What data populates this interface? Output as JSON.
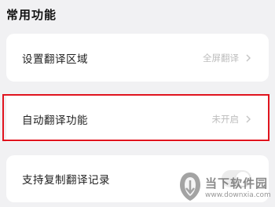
{
  "section": {
    "title": "常用功能"
  },
  "settings": [
    {
      "label": "设置翻译区域",
      "value": "全屏翻译"
    },
    {
      "label": "自动翻译功能",
      "value": "未开启"
    },
    {
      "label": "支持复制翻译记录"
    }
  ],
  "watermark": {
    "name": "当下软件园",
    "url": "www.downxia.com"
  },
  "colors": {
    "highlight_border": "#e0141e",
    "background": "#f1f1f3"
  },
  "icons": {
    "chevron": "chevron-right-icon",
    "watermark_logo": "downxia-logo-icon"
  }
}
